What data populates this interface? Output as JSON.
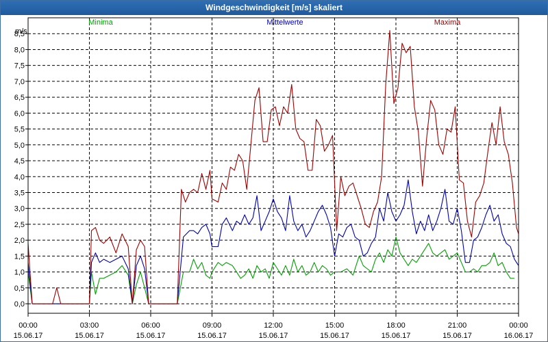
{
  "window": {
    "title": "Windgeschwindigkeit [m/s] skaliert"
  },
  "chart_data": {
    "type": "line",
    "ylabel": "m/s",
    "ylim": [
      -0.3,
      9.0
    ],
    "y_ticks": [
      "0,0",
      "0,5",
      "1,0",
      "1,5",
      "2,0",
      "2,5",
      "3,0",
      "3,5",
      "4,0",
      "4,5",
      "5,0",
      "5,5",
      "6,0",
      "6,5",
      "7,0",
      "7,5",
      "8,0",
      "8,5"
    ],
    "xlim_hours": [
      0,
      24
    ],
    "x_ticks": [
      {
        "time": "00:00",
        "date": "15.06.17"
      },
      {
        "time": "03:00",
        "date": "15.06.17"
      },
      {
        "time": "06:00",
        "date": "15.06.17"
      },
      {
        "time": "09:00",
        "date": "15.06.17"
      },
      {
        "time": "12:00",
        "date": "15.06.17"
      },
      {
        "time": "15:00",
        "date": "15.06.17"
      },
      {
        "time": "18:00",
        "date": "15.06.17"
      },
      {
        "time": "21:00",
        "date": "15.06.17"
      },
      {
        "time": "00:00",
        "date": "16.06.17"
      }
    ],
    "grid": true,
    "legend_position": "top",
    "series": [
      {
        "name": "Minima",
        "color": "#00a000",
        "points": [
          [
            0,
            1.0
          ],
          [
            0.2,
            0
          ],
          [
            1.5,
            0
          ],
          [
            1.7,
            0
          ],
          [
            3.0,
            0
          ],
          [
            3.1,
            1.0
          ],
          [
            3.3,
            0.3
          ],
          [
            3.5,
            0.8
          ],
          [
            3.7,
            0.8
          ],
          [
            4.0,
            0.9
          ],
          [
            4.3,
            1.0
          ],
          [
            4.6,
            1.2
          ],
          [
            4.9,
            0.9
          ],
          [
            5.1,
            0
          ],
          [
            5.3,
            0.6
          ],
          [
            5.5,
            1.0
          ],
          [
            5.7,
            0.5
          ],
          [
            5.9,
            0
          ],
          [
            7.3,
            0
          ],
          [
            7.6,
            1.0
          ],
          [
            7.9,
            1.0
          ],
          [
            8.1,
            1.4
          ],
          [
            8.3,
            1.1
          ],
          [
            8.5,
            1.3
          ],
          [
            8.7,
            0.9
          ],
          [
            8.9,
            0.8
          ],
          [
            9.0,
            1.0
          ],
          [
            9.3,
            1.3
          ],
          [
            9.5,
            1.2
          ],
          [
            9.7,
            1.3
          ],
          [
            10.0,
            1.2
          ],
          [
            10.2,
            1.0
          ],
          [
            10.4,
            0.8
          ],
          [
            10.6,
            0.9
          ],
          [
            10.8,
            1.1
          ],
          [
            11.0,
            0.8
          ],
          [
            11.2,
            1.2
          ],
          [
            11.4,
            1.0
          ],
          [
            11.6,
            1.1
          ],
          [
            11.8,
            0.8
          ],
          [
            12.0,
            1.3
          ],
          [
            12.2,
            1.1
          ],
          [
            12.4,
            0.9
          ],
          [
            12.6,
            1.2
          ],
          [
            12.8,
            0.9
          ],
          [
            13.0,
            1.4
          ],
          [
            13.2,
            1.0
          ],
          [
            13.4,
            1.2
          ],
          [
            13.6,
            0.9
          ],
          [
            13.8,
            1.0
          ],
          [
            14.0,
            1.3
          ],
          [
            14.2,
            1.0
          ],
          [
            14.4,
            1.2
          ],
          [
            14.6,
            1.1
          ],
          [
            14.8,
            0.9
          ],
          [
            15.0,
            1.0
          ],
          [
            15.3,
            1.0
          ],
          [
            15.6,
            1.1
          ],
          [
            15.9,
            0.9
          ],
          [
            16.2,
            1.5
          ],
          [
            16.4,
            1.2
          ],
          [
            16.6,
            1.1
          ],
          [
            16.8,
            1.0
          ],
          [
            17.0,
            1.4
          ],
          [
            17.2,
            1.6
          ],
          [
            17.4,
            1.3
          ],
          [
            17.6,
            1.7
          ],
          [
            17.8,
            1.5
          ],
          [
            18.0,
            2.1
          ],
          [
            18.2,
            1.6
          ],
          [
            18.4,
            1.4
          ],
          [
            18.6,
            1.2
          ],
          [
            18.8,
            1.4
          ],
          [
            19.0,
            1.3
          ],
          [
            19.2,
            1.5
          ],
          [
            19.4,
            1.7
          ],
          [
            19.6,
            1.9
          ],
          [
            19.8,
            1.6
          ],
          [
            20.0,
            1.5
          ],
          [
            20.2,
            1.6
          ],
          [
            20.4,
            1.7
          ],
          [
            20.6,
            1.4
          ],
          [
            20.8,
            1.5
          ],
          [
            21.0,
            1.6
          ],
          [
            21.2,
            1.3
          ],
          [
            21.4,
            1.0
          ],
          [
            21.6,
            1.0
          ],
          [
            21.8,
            1.1
          ],
          [
            22.0,
            1.0
          ],
          [
            22.2,
            1.2
          ],
          [
            22.4,
            1.2
          ],
          [
            22.6,
            1.3
          ],
          [
            22.8,
            1.6
          ],
          [
            23.0,
            1.2
          ],
          [
            23.2,
            1.3
          ],
          [
            23.4,
            1.0
          ],
          [
            23.6,
            0.8
          ],
          [
            23.8,
            0.8
          ]
        ]
      },
      {
        "name": "Mittelwerte",
        "color": "#0000b0",
        "points": [
          [
            0,
            1.3
          ],
          [
            0.2,
            0
          ],
          [
            1.5,
            0
          ],
          [
            1.7,
            0
          ],
          [
            3.0,
            0
          ],
          [
            3.1,
            1.3
          ],
          [
            3.3,
            1.6
          ],
          [
            3.5,
            1.3
          ],
          [
            3.7,
            1.4
          ],
          [
            4.0,
            1.3
          ],
          [
            4.3,
            1.4
          ],
          [
            4.6,
            1.5
          ],
          [
            4.9,
            1.1
          ],
          [
            5.1,
            0
          ],
          [
            5.3,
            1.2
          ],
          [
            5.5,
            1.5
          ],
          [
            5.7,
            1.1
          ],
          [
            5.9,
            0
          ],
          [
            7.3,
            0
          ],
          [
            7.6,
            2.1
          ],
          [
            7.9,
            2.3
          ],
          [
            8.1,
            2.3
          ],
          [
            8.3,
            2.2
          ],
          [
            8.5,
            2.4
          ],
          [
            8.7,
            2.5
          ],
          [
            8.9,
            2.2
          ],
          [
            9.0,
            1.8
          ],
          [
            9.3,
            1.8
          ],
          [
            9.5,
            2.5
          ],
          [
            9.7,
            2.7
          ],
          [
            10.0,
            2.3
          ],
          [
            10.2,
            2.6
          ],
          [
            10.4,
            2.5
          ],
          [
            10.6,
            2.8
          ],
          [
            10.8,
            2.5
          ],
          [
            11.0,
            2.7
          ],
          [
            11.2,
            3.4
          ],
          [
            11.4,
            2.3
          ],
          [
            11.6,
            2.6
          ],
          [
            11.8,
            2.9
          ],
          [
            12.0,
            3.3
          ],
          [
            12.2,
            2.9
          ],
          [
            12.4,
            2.7
          ],
          [
            12.6,
            2.3
          ],
          [
            12.8,
            3.4
          ],
          [
            13.0,
            2.6
          ],
          [
            13.2,
            2.3
          ],
          [
            13.4,
            2.5
          ],
          [
            13.6,
            2.1
          ],
          [
            13.8,
            2.3
          ],
          [
            14.0,
            2.6
          ],
          [
            14.2,
            2.9
          ],
          [
            14.4,
            3.1
          ],
          [
            14.6,
            2.8
          ],
          [
            14.8,
            2.4
          ],
          [
            15.0,
            1.5
          ],
          [
            15.2,
            2.2
          ],
          [
            15.4,
            2.1
          ],
          [
            15.6,
            2.4
          ],
          [
            15.8,
            2.5
          ],
          [
            16.0,
            2.1
          ],
          [
            16.2,
            2.0
          ],
          [
            16.4,
            1.5
          ],
          [
            16.6,
            1.6
          ],
          [
            16.8,
            1.9
          ],
          [
            17.0,
            2.1
          ],
          [
            17.2,
            3.0
          ],
          [
            17.4,
            2.6
          ],
          [
            17.6,
            3.5
          ],
          [
            17.8,
            2.9
          ],
          [
            18.0,
            2.6
          ],
          [
            18.2,
            2.8
          ],
          [
            18.4,
            3.1
          ],
          [
            18.6,
            3.9
          ],
          [
            18.8,
            2.9
          ],
          [
            19.0,
            2.2
          ],
          [
            19.2,
            2.6
          ],
          [
            19.4,
            2.3
          ],
          [
            19.6,
            2.8
          ],
          [
            19.8,
            2.3
          ],
          [
            20.0,
            2.6
          ],
          [
            20.2,
            3.0
          ],
          [
            20.4,
            3.6
          ],
          [
            20.6,
            2.6
          ],
          [
            20.8,
            2.5
          ],
          [
            21.0,
            3.0
          ],
          [
            21.2,
            2.3
          ],
          [
            21.4,
            1.3
          ],
          [
            21.6,
            1.3
          ],
          [
            21.8,
            2.0
          ],
          [
            22.0,
            2.1
          ],
          [
            22.2,
            2.4
          ],
          [
            22.4,
            2.8
          ],
          [
            22.6,
            3.1
          ],
          [
            22.8,
            2.6
          ],
          [
            23.0,
            2.8
          ],
          [
            23.2,
            2.2
          ],
          [
            23.4,
            1.9
          ],
          [
            23.6,
            1.8
          ],
          [
            23.8,
            1.4
          ],
          [
            24.0,
            1.2
          ]
        ]
      },
      {
        "name": "Maxima",
        "color": "#a00000",
        "points": [
          [
            0,
            1.9
          ],
          [
            0.2,
            0
          ],
          [
            1.2,
            0
          ],
          [
            1.4,
            0.5
          ],
          [
            1.6,
            0
          ],
          [
            3.0,
            0
          ],
          [
            3.1,
            2.3
          ],
          [
            3.3,
            2.4
          ],
          [
            3.5,
            2.0
          ],
          [
            3.7,
            1.9
          ],
          [
            4.0,
            2.1
          ],
          [
            4.3,
            1.6
          ],
          [
            4.6,
            2.2
          ],
          [
            4.9,
            1.8
          ],
          [
            5.1,
            0
          ],
          [
            5.3,
            1.7
          ],
          [
            5.5,
            2.0
          ],
          [
            5.7,
            1.8
          ],
          [
            5.9,
            0
          ],
          [
            7.3,
            0
          ],
          [
            7.5,
            3.6
          ],
          [
            7.7,
            3.2
          ],
          [
            7.9,
            3.5
          ],
          [
            8.1,
            3.6
          ],
          [
            8.3,
            3.5
          ],
          [
            8.5,
            4.1
          ],
          [
            8.7,
            3.6
          ],
          [
            8.9,
            4.2
          ],
          [
            9.0,
            3.3
          ],
          [
            9.3,
            3.2
          ],
          [
            9.5,
            3.8
          ],
          [
            9.7,
            3.6
          ],
          [
            9.9,
            4.3
          ],
          [
            10.1,
            4.2
          ],
          [
            10.3,
            4.7
          ],
          [
            10.5,
            4.5
          ],
          [
            10.7,
            3.6
          ],
          [
            10.9,
            5.0
          ],
          [
            11.1,
            6.4
          ],
          [
            11.3,
            6.8
          ],
          [
            11.5,
            5.1
          ],
          [
            11.7,
            5.1
          ],
          [
            11.9,
            6.1
          ],
          [
            12.1,
            6.2
          ],
          [
            12.3,
            5.6
          ],
          [
            12.5,
            6.2
          ],
          [
            12.7,
            6.0
          ],
          [
            12.9,
            6.9
          ],
          [
            13.1,
            5.5
          ],
          [
            13.3,
            5.2
          ],
          [
            13.5,
            5.1
          ],
          [
            13.7,
            4.2
          ],
          [
            13.9,
            4.2
          ],
          [
            14.1,
            5.8
          ],
          [
            14.3,
            5.6
          ],
          [
            14.5,
            4.8
          ],
          [
            14.7,
            5.0
          ],
          [
            14.9,
            5.3
          ],
          [
            15.1,
            2.3
          ],
          [
            15.3,
            4.0
          ],
          [
            15.5,
            3.4
          ],
          [
            15.7,
            3.7
          ],
          [
            15.9,
            3.8
          ],
          [
            16.1,
            3.4
          ],
          [
            16.3,
            3.0
          ],
          [
            16.5,
            2.5
          ],
          [
            16.7,
            2.4
          ],
          [
            16.9,
            2.9
          ],
          [
            17.1,
            3.2
          ],
          [
            17.3,
            4.0
          ],
          [
            17.5,
            6.9
          ],
          [
            17.7,
            8.6
          ],
          [
            17.9,
            6.3
          ],
          [
            18.1,
            6.8
          ],
          [
            18.3,
            8.2
          ],
          [
            18.5,
            7.9
          ],
          [
            18.7,
            8.1
          ],
          [
            18.9,
            6.2
          ],
          [
            19.1,
            5.4
          ],
          [
            19.3,
            3.7
          ],
          [
            19.5,
            5.2
          ],
          [
            19.7,
            6.4
          ],
          [
            19.9,
            6.1
          ],
          [
            20.1,
            5.0
          ],
          [
            20.3,
            4.7
          ],
          [
            20.5,
            5.5
          ],
          [
            20.7,
            5.4
          ],
          [
            20.9,
            6.2
          ],
          [
            21.1,
            3.9
          ],
          [
            21.3,
            3.8
          ],
          [
            21.5,
            2.6
          ],
          [
            21.7,
            2.1
          ],
          [
            21.9,
            3.2
          ],
          [
            22.1,
            3.4
          ],
          [
            22.3,
            3.8
          ],
          [
            22.5,
            4.8
          ],
          [
            22.7,
            5.7
          ],
          [
            22.9,
            5.0
          ],
          [
            23.1,
            6.2
          ],
          [
            23.3,
            5.1
          ],
          [
            23.5,
            4.7
          ],
          [
            23.7,
            3.8
          ],
          [
            23.9,
            2.4
          ],
          [
            24.0,
            2.2
          ]
        ]
      }
    ]
  }
}
